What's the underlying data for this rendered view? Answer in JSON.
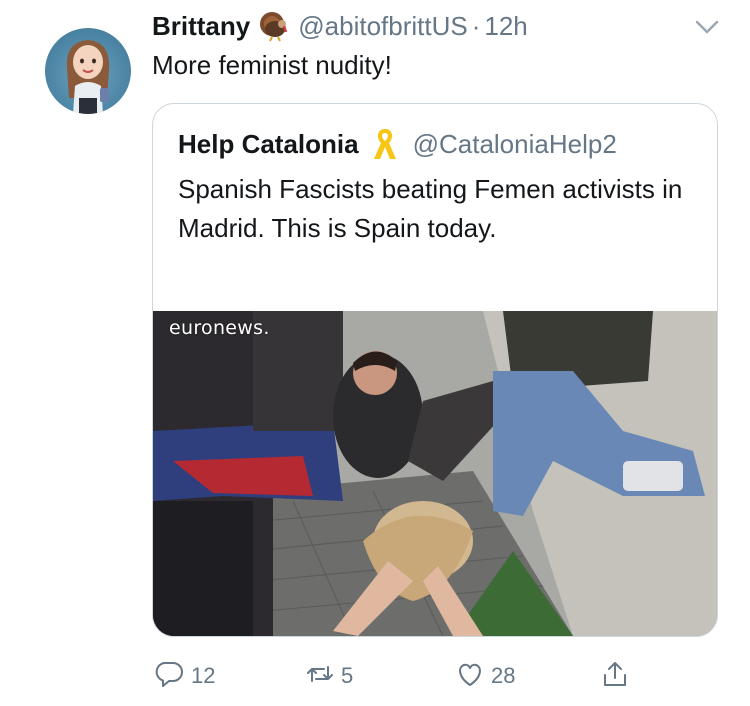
{
  "tweet": {
    "author": {
      "display_name": "Brittany",
      "handle": "@abitofbrittUS",
      "badge_icon": "turkey-emoji-icon"
    },
    "separator": "·",
    "time": "12h",
    "text": "More feminist nudity!"
  },
  "quoted_tweet": {
    "display_name": "Help Catalonia",
    "badge_icon": "yellow-ribbon-icon",
    "handle": "@CataloniaHelp2",
    "text": "Spanish Fascists beating Femen activists in Madrid. This is Spain today.",
    "media": {
      "watermark": "euronews."
    }
  },
  "actions": {
    "reply_count": "12",
    "retweet_count": "5",
    "like_count": "28"
  },
  "colors": {
    "text": "#14171a",
    "secondary": "#657786",
    "border": "#ccd6dd",
    "ribbon": "#f7c614"
  }
}
